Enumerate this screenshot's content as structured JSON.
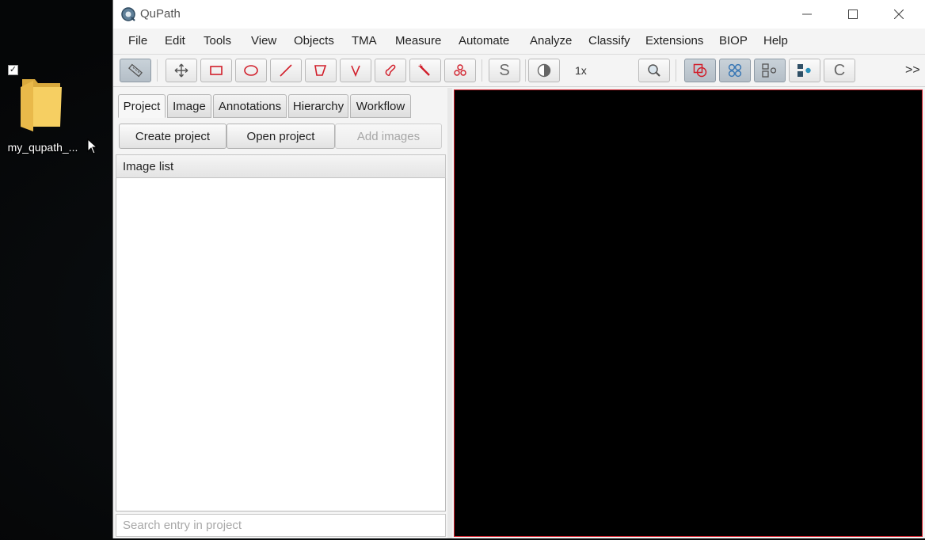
{
  "desktop": {
    "folder_label": "my_qupath_...",
    "checkbox_mark": "✓"
  },
  "window": {
    "title": "QuPath"
  },
  "menu": [
    "File",
    "Edit",
    "Tools",
    "View",
    "Objects",
    "TMA",
    "Measure",
    "Automate",
    "Analyze",
    "Classify",
    "Extensions",
    "BIOP",
    "Help"
  ],
  "toolbar": {
    "zoom": "1x",
    "more": ">>",
    "stain_label": "S",
    "cells_label": "C"
  },
  "tabs": [
    "Project",
    "Image",
    "Annotations",
    "Hierarchy",
    "Workflow"
  ],
  "project_buttons": {
    "create": "Create project",
    "open": "Open project",
    "add": "Add images"
  },
  "image_list": {
    "header": "Image list"
  },
  "search": {
    "placeholder": "Search entry in project",
    "value": ""
  },
  "colors": {
    "accent_red": "#d11e2a",
    "tool_blue": "#3a78b5",
    "viewer_bg": "#000000"
  },
  "icons": {
    "tools": [
      "measure-ruler-icon",
      "move-icon",
      "rectangle-icon",
      "ellipse-icon",
      "line-icon",
      "polygon-icon",
      "polyline-icon",
      "brush-icon",
      "wand-icon",
      "points-icon"
    ]
  }
}
